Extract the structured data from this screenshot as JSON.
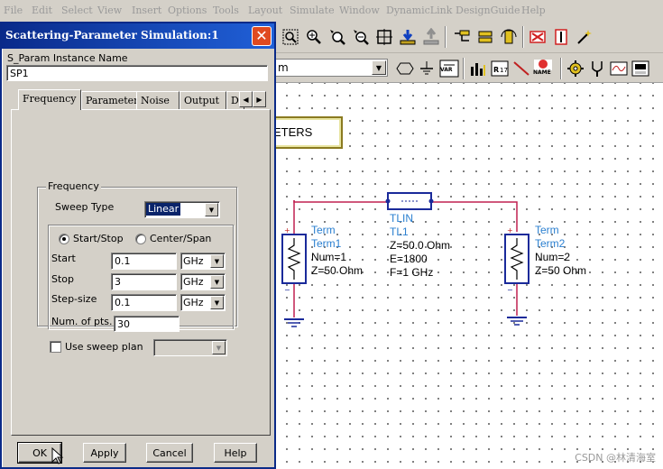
{
  "menu": [
    "File",
    "Edit",
    "Select",
    "View",
    "Insert",
    "Options",
    "Tools",
    "Layout",
    "Simulate",
    "Window",
    "DynamicLink",
    "DesignGuide",
    "Help"
  ],
  "main_toolbar": {
    "component_combo_value": "m"
  },
  "toolbar_buttons": {
    "var_label": "VAR",
    "name_label": "NAME"
  },
  "dialog": {
    "title": "Scattering-Parameter Simulation:1",
    "instance_name_label": "S_Param Instance Name",
    "instance_name_value": "SP1",
    "tabs": [
      "Frequency",
      "Parameters",
      "Noise",
      "Output",
      "Di"
    ],
    "frequency_group_label": "Frequency",
    "sweep_type_label": "Sweep Type",
    "sweep_type_value": "Linear",
    "radio_start_stop": "Start/Stop",
    "radio_center_span": "Center/Span",
    "start_label": "Start",
    "start_value": "0.1",
    "start_unit": "GHz",
    "stop_label": "Stop",
    "stop_value": "3",
    "stop_unit": "GHz",
    "step_label": "Step-size",
    "step_value": "0.1",
    "step_unit": "GHz",
    "num_pts_label": "Num. of pts.",
    "num_pts_value": "30",
    "sweep_plan_label": "Use sweep plan",
    "buttons": {
      "ok": "OK",
      "apply": "Apply",
      "cancel": "Cancel",
      "help": "Help"
    }
  },
  "schematic": {
    "sp_block_text": "ETERS",
    "term1": {
      "label": "Term",
      "name": "Term1",
      "num": "Num=1",
      "z": "Z=50 Ohm"
    },
    "term2": {
      "label": "Term",
      "name": "Term2",
      "num": "Num=2",
      "z": "Z=50 Ohm"
    },
    "tlin": {
      "label": "TLIN",
      "name": "TL1",
      "z": "Z=50.0 Ohm",
      "e": "E=1800",
      "f": "F=1 GHz"
    }
  },
  "watermark": "CSDN @林清海室"
}
